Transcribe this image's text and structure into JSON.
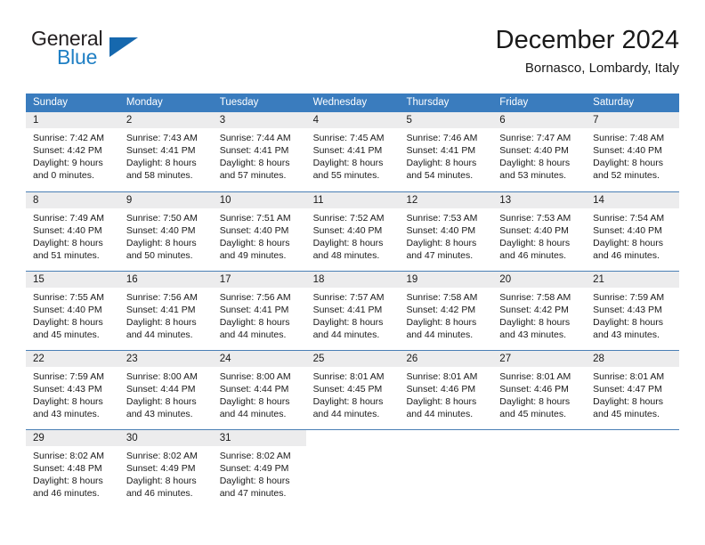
{
  "brand": {
    "word_one": "General",
    "word_two": "Blue",
    "accent_color": "#1668ae",
    "text_color": "#231f20",
    "logo_icon": "triangle-logo-icon"
  },
  "header": {
    "title": "December 2024",
    "subtitle": "Bornasco, Lombardy, Italy"
  },
  "theme": {
    "header_bar_color": "#3a7cbe",
    "day_number_bg": "#ececed",
    "row_divider_color": "#4a7fb5"
  },
  "calendar": {
    "weekday_headers": [
      "Sunday",
      "Monday",
      "Tuesday",
      "Wednesday",
      "Thursday",
      "Friday",
      "Saturday"
    ],
    "weeks": [
      [
        {
          "day": "1",
          "sunrise": "Sunrise: 7:42 AM",
          "sunset": "Sunset: 4:42 PM",
          "daylight_line1": "Daylight: 9 hours",
          "daylight_line2": "and 0 minutes."
        },
        {
          "day": "2",
          "sunrise": "Sunrise: 7:43 AM",
          "sunset": "Sunset: 4:41 PM",
          "daylight_line1": "Daylight: 8 hours",
          "daylight_line2": "and 58 minutes."
        },
        {
          "day": "3",
          "sunrise": "Sunrise: 7:44 AM",
          "sunset": "Sunset: 4:41 PM",
          "daylight_line1": "Daylight: 8 hours",
          "daylight_line2": "and 57 minutes."
        },
        {
          "day": "4",
          "sunrise": "Sunrise: 7:45 AM",
          "sunset": "Sunset: 4:41 PM",
          "daylight_line1": "Daylight: 8 hours",
          "daylight_line2": "and 55 minutes."
        },
        {
          "day": "5",
          "sunrise": "Sunrise: 7:46 AM",
          "sunset": "Sunset: 4:41 PM",
          "daylight_line1": "Daylight: 8 hours",
          "daylight_line2": "and 54 minutes."
        },
        {
          "day": "6",
          "sunrise": "Sunrise: 7:47 AM",
          "sunset": "Sunset: 4:40 PM",
          "daylight_line1": "Daylight: 8 hours",
          "daylight_line2": "and 53 minutes."
        },
        {
          "day": "7",
          "sunrise": "Sunrise: 7:48 AM",
          "sunset": "Sunset: 4:40 PM",
          "daylight_line1": "Daylight: 8 hours",
          "daylight_line2": "and 52 minutes."
        }
      ],
      [
        {
          "day": "8",
          "sunrise": "Sunrise: 7:49 AM",
          "sunset": "Sunset: 4:40 PM",
          "daylight_line1": "Daylight: 8 hours",
          "daylight_line2": "and 51 minutes."
        },
        {
          "day": "9",
          "sunrise": "Sunrise: 7:50 AM",
          "sunset": "Sunset: 4:40 PM",
          "daylight_line1": "Daylight: 8 hours",
          "daylight_line2": "and 50 minutes."
        },
        {
          "day": "10",
          "sunrise": "Sunrise: 7:51 AM",
          "sunset": "Sunset: 4:40 PM",
          "daylight_line1": "Daylight: 8 hours",
          "daylight_line2": "and 49 minutes."
        },
        {
          "day": "11",
          "sunrise": "Sunrise: 7:52 AM",
          "sunset": "Sunset: 4:40 PM",
          "daylight_line1": "Daylight: 8 hours",
          "daylight_line2": "and 48 minutes."
        },
        {
          "day": "12",
          "sunrise": "Sunrise: 7:53 AM",
          "sunset": "Sunset: 4:40 PM",
          "daylight_line1": "Daylight: 8 hours",
          "daylight_line2": "and 47 minutes."
        },
        {
          "day": "13",
          "sunrise": "Sunrise: 7:53 AM",
          "sunset": "Sunset: 4:40 PM",
          "daylight_line1": "Daylight: 8 hours",
          "daylight_line2": "and 46 minutes."
        },
        {
          "day": "14",
          "sunrise": "Sunrise: 7:54 AM",
          "sunset": "Sunset: 4:40 PM",
          "daylight_line1": "Daylight: 8 hours",
          "daylight_line2": "and 46 minutes."
        }
      ],
      [
        {
          "day": "15",
          "sunrise": "Sunrise: 7:55 AM",
          "sunset": "Sunset: 4:40 PM",
          "daylight_line1": "Daylight: 8 hours",
          "daylight_line2": "and 45 minutes."
        },
        {
          "day": "16",
          "sunrise": "Sunrise: 7:56 AM",
          "sunset": "Sunset: 4:41 PM",
          "daylight_line1": "Daylight: 8 hours",
          "daylight_line2": "and 44 minutes."
        },
        {
          "day": "17",
          "sunrise": "Sunrise: 7:56 AM",
          "sunset": "Sunset: 4:41 PM",
          "daylight_line1": "Daylight: 8 hours",
          "daylight_line2": "and 44 minutes."
        },
        {
          "day": "18",
          "sunrise": "Sunrise: 7:57 AM",
          "sunset": "Sunset: 4:41 PM",
          "daylight_line1": "Daylight: 8 hours",
          "daylight_line2": "and 44 minutes."
        },
        {
          "day": "19",
          "sunrise": "Sunrise: 7:58 AM",
          "sunset": "Sunset: 4:42 PM",
          "daylight_line1": "Daylight: 8 hours",
          "daylight_line2": "and 44 minutes."
        },
        {
          "day": "20",
          "sunrise": "Sunrise: 7:58 AM",
          "sunset": "Sunset: 4:42 PM",
          "daylight_line1": "Daylight: 8 hours",
          "daylight_line2": "and 43 minutes."
        },
        {
          "day": "21",
          "sunrise": "Sunrise: 7:59 AM",
          "sunset": "Sunset: 4:43 PM",
          "daylight_line1": "Daylight: 8 hours",
          "daylight_line2": "and 43 minutes."
        }
      ],
      [
        {
          "day": "22",
          "sunrise": "Sunrise: 7:59 AM",
          "sunset": "Sunset: 4:43 PM",
          "daylight_line1": "Daylight: 8 hours",
          "daylight_line2": "and 43 minutes."
        },
        {
          "day": "23",
          "sunrise": "Sunrise: 8:00 AM",
          "sunset": "Sunset: 4:44 PM",
          "daylight_line1": "Daylight: 8 hours",
          "daylight_line2": "and 43 minutes."
        },
        {
          "day": "24",
          "sunrise": "Sunrise: 8:00 AM",
          "sunset": "Sunset: 4:44 PM",
          "daylight_line1": "Daylight: 8 hours",
          "daylight_line2": "and 44 minutes."
        },
        {
          "day": "25",
          "sunrise": "Sunrise: 8:01 AM",
          "sunset": "Sunset: 4:45 PM",
          "daylight_line1": "Daylight: 8 hours",
          "daylight_line2": "and 44 minutes."
        },
        {
          "day": "26",
          "sunrise": "Sunrise: 8:01 AM",
          "sunset": "Sunset: 4:46 PM",
          "daylight_line1": "Daylight: 8 hours",
          "daylight_line2": "and 44 minutes."
        },
        {
          "day": "27",
          "sunrise": "Sunrise: 8:01 AM",
          "sunset": "Sunset: 4:46 PM",
          "daylight_line1": "Daylight: 8 hours",
          "daylight_line2": "and 45 minutes."
        },
        {
          "day": "28",
          "sunrise": "Sunrise: 8:01 AM",
          "sunset": "Sunset: 4:47 PM",
          "daylight_line1": "Daylight: 8 hours",
          "daylight_line2": "and 45 minutes."
        }
      ],
      [
        {
          "day": "29",
          "sunrise": "Sunrise: 8:02 AM",
          "sunset": "Sunset: 4:48 PM",
          "daylight_line1": "Daylight: 8 hours",
          "daylight_line2": "and 46 minutes."
        },
        {
          "day": "30",
          "sunrise": "Sunrise: 8:02 AM",
          "sunset": "Sunset: 4:49 PM",
          "daylight_line1": "Daylight: 8 hours",
          "daylight_line2": "and 46 minutes."
        },
        {
          "day": "31",
          "sunrise": "Sunrise: 8:02 AM",
          "sunset": "Sunset: 4:49 PM",
          "daylight_line1": "Daylight: 8 hours",
          "daylight_line2": "and 47 minutes."
        },
        {
          "day": "",
          "sunrise": "",
          "sunset": "",
          "daylight_line1": "",
          "daylight_line2": ""
        },
        {
          "day": "",
          "sunrise": "",
          "sunset": "",
          "daylight_line1": "",
          "daylight_line2": ""
        },
        {
          "day": "",
          "sunrise": "",
          "sunset": "",
          "daylight_line1": "",
          "daylight_line2": ""
        },
        {
          "day": "",
          "sunrise": "",
          "sunset": "",
          "daylight_line1": "",
          "daylight_line2": ""
        }
      ]
    ]
  }
}
